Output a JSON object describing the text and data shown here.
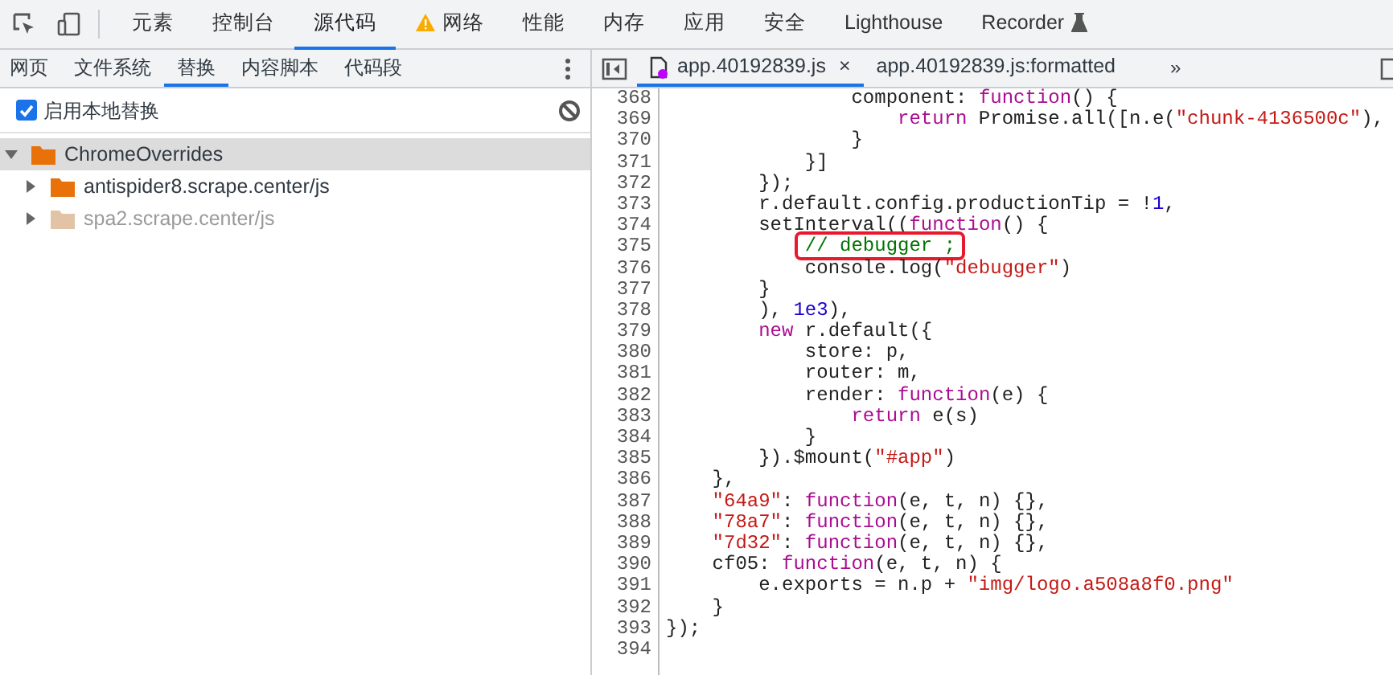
{
  "toolbar": {
    "tabs": [
      {
        "label": "元素",
        "selected": false,
        "kind": "plain"
      },
      {
        "label": "控制台",
        "selected": false,
        "kind": "plain"
      },
      {
        "label": "源代码",
        "selected": true,
        "kind": "plain"
      },
      {
        "label": "网络",
        "selected": false,
        "kind": "warning"
      },
      {
        "label": "性能",
        "selected": false,
        "kind": "plain"
      },
      {
        "label": "内存",
        "selected": false,
        "kind": "plain"
      },
      {
        "label": "应用",
        "selected": false,
        "kind": "plain"
      },
      {
        "label": "安全",
        "selected": false,
        "kind": "plain"
      },
      {
        "label": "Lighthouse",
        "selected": false,
        "kind": "plain"
      },
      {
        "label": "Recorder",
        "selected": false,
        "kind": "experimental"
      }
    ]
  },
  "navigator": {
    "tabs": [
      {
        "label": "网页",
        "selected": false
      },
      {
        "label": "文件系统",
        "selected": false
      },
      {
        "label": "替换",
        "selected": true
      },
      {
        "label": "内容脚本",
        "selected": false
      },
      {
        "label": "代码段",
        "selected": false
      }
    ],
    "enable_overrides": {
      "label": "启用本地替换",
      "checked": true
    },
    "tree": [
      {
        "label": "ChromeOverrides",
        "expanded": true,
        "selected": true,
        "muted": false,
        "children": [
          {
            "label": "antispider8.scrape.center/js",
            "expanded": false,
            "selected": false,
            "muted": false
          },
          {
            "label": "spa2.scrape.center/js",
            "expanded": false,
            "selected": false,
            "muted": true
          }
        ]
      }
    ]
  },
  "editor": {
    "tabs": [
      {
        "label": "app.40192839.js",
        "selected": true,
        "modified": true,
        "close": "×"
      },
      {
        "label": "app.40192839.js:formatted",
        "selected": false,
        "modified": false
      }
    ],
    "overflow": "»",
    "lines": [
      {
        "number": "368",
        "tokens": [
          {
            "kind": "plain",
            "text": "                component: "
          },
          {
            "kind": "keyword",
            "text": "function"
          },
          {
            "kind": "plain",
            "text": "() {"
          }
        ]
      },
      {
        "number": "369",
        "tokens": [
          {
            "kind": "keyword",
            "text": "                    return"
          },
          {
            "kind": "plain",
            "text": " Promise.all([n.e("
          },
          {
            "kind": "string",
            "text": "\"chunk-4136500c\""
          },
          {
            "kind": "plain",
            "text": "),"
          }
        ]
      },
      {
        "number": "370",
        "tokens": [
          {
            "kind": "plain",
            "text": "                }"
          }
        ]
      },
      {
        "number": "371",
        "tokens": [
          {
            "kind": "plain",
            "text": "            }]"
          }
        ]
      },
      {
        "number": "372",
        "tokens": [
          {
            "kind": "plain",
            "text": "        });"
          }
        ]
      },
      {
        "number": "373",
        "tokens": [
          {
            "kind": "plain",
            "text": "        r.default.config.productionTip = !"
          },
          {
            "kind": "number",
            "text": "1"
          },
          {
            "kind": "plain",
            "text": ","
          }
        ]
      },
      {
        "number": "374",
        "tokens": [
          {
            "kind": "plain",
            "text": "        setInterval(("
          },
          {
            "kind": "keyword",
            "text": "function"
          },
          {
            "kind": "plain",
            "text": "() {"
          }
        ]
      },
      {
        "number": "375",
        "tokens": [
          {
            "kind": "comment",
            "text": "            // debugger ;",
            "highlighted": true
          }
        ]
      },
      {
        "number": "376",
        "tokens": [
          {
            "kind": "plain",
            "text": "            console.log("
          },
          {
            "kind": "string",
            "text": "\"debugger\""
          },
          {
            "kind": "plain",
            "text": ")"
          }
        ]
      },
      {
        "number": "377",
        "tokens": [
          {
            "kind": "plain",
            "text": "        }"
          }
        ]
      },
      {
        "number": "378",
        "tokens": [
          {
            "kind": "plain",
            "text": "        ), "
          },
          {
            "kind": "number",
            "text": "1e3"
          },
          {
            "kind": "plain",
            "text": "),"
          }
        ]
      },
      {
        "number": "379",
        "tokens": [
          {
            "kind": "keyword",
            "text": "        new"
          },
          {
            "kind": "plain",
            "text": " r.default({"
          }
        ]
      },
      {
        "number": "380",
        "tokens": [
          {
            "kind": "plain",
            "text": "            store: p,"
          }
        ]
      },
      {
        "number": "381",
        "tokens": [
          {
            "kind": "plain",
            "text": "            router: m,"
          }
        ]
      },
      {
        "number": "382",
        "tokens": [
          {
            "kind": "plain",
            "text": "            render: "
          },
          {
            "kind": "keyword",
            "text": "function"
          },
          {
            "kind": "plain",
            "text": "(e) {"
          }
        ]
      },
      {
        "number": "383",
        "tokens": [
          {
            "kind": "keyword",
            "text": "                return"
          },
          {
            "kind": "plain",
            "text": " e(s)"
          }
        ]
      },
      {
        "number": "384",
        "tokens": [
          {
            "kind": "plain",
            "text": "            }"
          }
        ]
      },
      {
        "number": "385",
        "tokens": [
          {
            "kind": "plain",
            "text": "        }).$mount("
          },
          {
            "kind": "string",
            "text": "\"#app\""
          },
          {
            "kind": "plain",
            "text": ")"
          }
        ]
      },
      {
        "number": "386",
        "tokens": [
          {
            "kind": "plain",
            "text": "    },"
          }
        ]
      },
      {
        "number": "387",
        "tokens": [
          {
            "kind": "string",
            "text": "    \"64a9\""
          },
          {
            "kind": "plain",
            "text": ": "
          },
          {
            "kind": "keyword",
            "text": "function"
          },
          {
            "kind": "plain",
            "text": "(e, t, n) {},"
          }
        ]
      },
      {
        "number": "388",
        "tokens": [
          {
            "kind": "string",
            "text": "    \"78a7\""
          },
          {
            "kind": "plain",
            "text": ": "
          },
          {
            "kind": "keyword",
            "text": "function"
          },
          {
            "kind": "plain",
            "text": "(e, t, n) {},"
          }
        ]
      },
      {
        "number": "389",
        "tokens": [
          {
            "kind": "string",
            "text": "    \"7d32\""
          },
          {
            "kind": "plain",
            "text": ": "
          },
          {
            "kind": "keyword",
            "text": "function"
          },
          {
            "kind": "plain",
            "text": "(e, t, n) {},"
          }
        ]
      },
      {
        "number": "390",
        "tokens": [
          {
            "kind": "plain",
            "text": "    cf05: "
          },
          {
            "kind": "keyword",
            "text": "function"
          },
          {
            "kind": "plain",
            "text": "(e, t, n) {"
          }
        ]
      },
      {
        "number": "391",
        "tokens": [
          {
            "kind": "plain",
            "text": "        e.exports = n.p + "
          },
          {
            "kind": "string",
            "text": "\"img/logo.a508a8f0.png\""
          }
        ]
      },
      {
        "number": "392",
        "tokens": [
          {
            "kind": "plain",
            "text": "    }"
          }
        ]
      },
      {
        "number": "393",
        "tokens": [
          {
            "kind": "plain",
            "text": "});"
          }
        ]
      },
      {
        "number": "394"
      }
    ]
  }
}
